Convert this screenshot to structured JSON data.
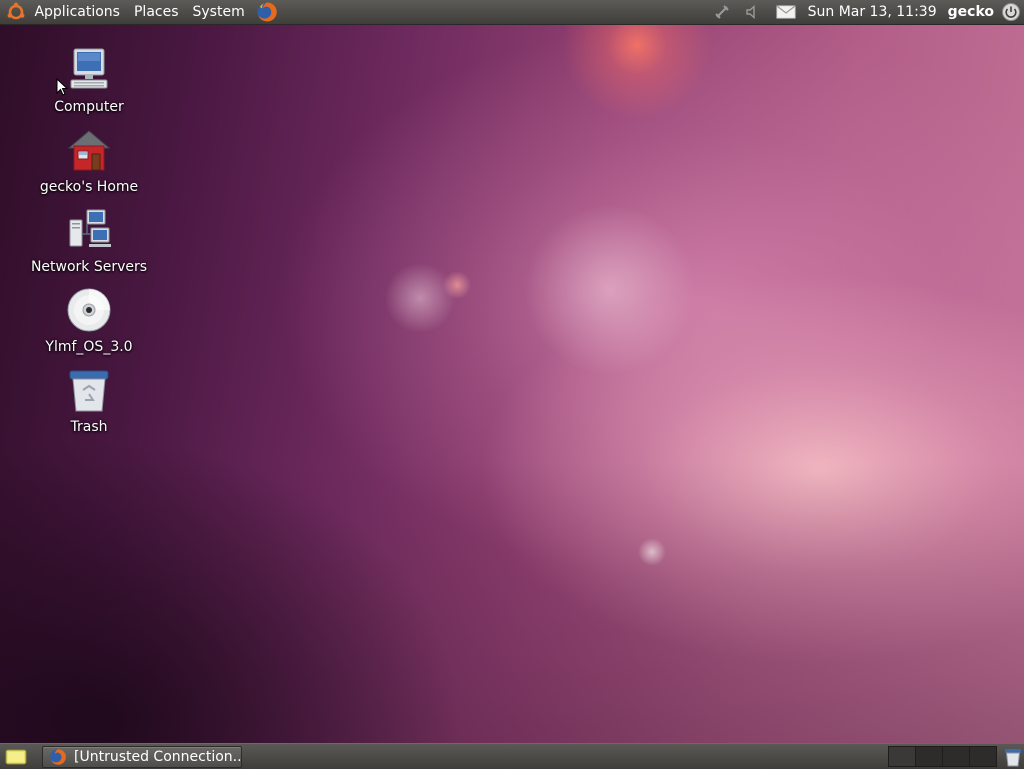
{
  "top_panel": {
    "menus": [
      {
        "label": "Applications"
      },
      {
        "label": "Places"
      },
      {
        "label": "System"
      }
    ],
    "launchers": [
      {
        "icon": "firefox-icon"
      }
    ],
    "tray": {
      "network_icon": "network-disconnected-icon",
      "volume_icon": "volume-icon",
      "mail_icon": "mail-icon",
      "clock": "Sun Mar 13, 11:39",
      "username": "gecko",
      "power_icon": "power-icon"
    }
  },
  "desktop": {
    "icons": [
      {
        "label": "Computer",
        "icon": "computer-icon"
      },
      {
        "label": "gecko's Home",
        "icon": "home-folder-icon"
      },
      {
        "label": "Network Servers",
        "icon": "network-servers-icon"
      },
      {
        "label": "Ylmf_OS_3.0",
        "icon": "cd-disc-icon"
      },
      {
        "label": "Trash",
        "icon": "trash-icon"
      }
    ]
  },
  "bottom_panel": {
    "show_desktop_icon": "show-desktop-icon",
    "tasks": [
      {
        "label": "[Untrusted Connection...",
        "icon": "firefox-icon"
      }
    ],
    "workspaces": 4,
    "trash_icon": "trash-applet-icon"
  },
  "colors": {
    "panel": "#3f3e3b",
    "wallpaper_dark": "#2e0d27",
    "wallpaper_light": "#c7769a"
  }
}
